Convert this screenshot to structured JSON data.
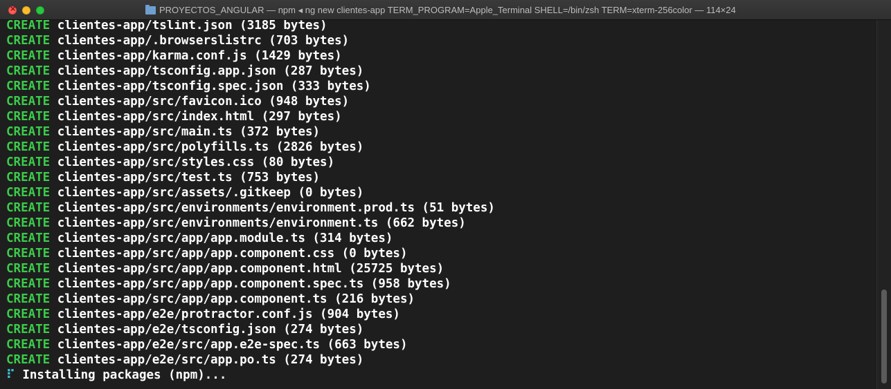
{
  "window": {
    "title": "PROYECTOS_ANGULAR — npm ◂ ng new clientes-app TERM_PROGRAM=Apple_Terminal SHELL=/bin/zsh TERM=xterm-256color — 114×24"
  },
  "colors": {
    "background": "#1e1e1e",
    "keyword_green": "#3bcc4a",
    "text": "#ffffff",
    "spinner_cyan": "#3cc4d8"
  },
  "terminal": {
    "lines": [
      {
        "kw": "CREATE",
        "text": " clientes-app/tslint.json (3185 bytes)"
      },
      {
        "kw": "CREATE",
        "text": " clientes-app/.browserslistrc (703 bytes)"
      },
      {
        "kw": "CREATE",
        "text": " clientes-app/karma.conf.js (1429 bytes)"
      },
      {
        "kw": "CREATE",
        "text": " clientes-app/tsconfig.app.json (287 bytes)"
      },
      {
        "kw": "CREATE",
        "text": " clientes-app/tsconfig.spec.json (333 bytes)"
      },
      {
        "kw": "CREATE",
        "text": " clientes-app/src/favicon.ico (948 bytes)"
      },
      {
        "kw": "CREATE",
        "text": " clientes-app/src/index.html (297 bytes)"
      },
      {
        "kw": "CREATE",
        "text": " clientes-app/src/main.ts (372 bytes)"
      },
      {
        "kw": "CREATE",
        "text": " clientes-app/src/polyfills.ts (2826 bytes)"
      },
      {
        "kw": "CREATE",
        "text": " clientes-app/src/styles.css (80 bytes)"
      },
      {
        "kw": "CREATE",
        "text": " clientes-app/src/test.ts (753 bytes)"
      },
      {
        "kw": "CREATE",
        "text": " clientes-app/src/assets/.gitkeep (0 bytes)"
      },
      {
        "kw": "CREATE",
        "text": " clientes-app/src/environments/environment.prod.ts (51 bytes)"
      },
      {
        "kw": "CREATE",
        "text": " clientes-app/src/environments/environment.ts (662 bytes)"
      },
      {
        "kw": "CREATE",
        "text": " clientes-app/src/app/app.module.ts (314 bytes)"
      },
      {
        "kw": "CREATE",
        "text": " clientes-app/src/app/app.component.css (0 bytes)"
      },
      {
        "kw": "CREATE",
        "text": " clientes-app/src/app/app.component.html (25725 bytes)"
      },
      {
        "kw": "CREATE",
        "text": " clientes-app/src/app/app.component.spec.ts (958 bytes)"
      },
      {
        "kw": "CREATE",
        "text": " clientes-app/src/app/app.component.ts (216 bytes)"
      },
      {
        "kw": "CREATE",
        "text": " clientes-app/e2e/protractor.conf.js (904 bytes)"
      },
      {
        "kw": "CREATE",
        "text": " clientes-app/e2e/tsconfig.json (274 bytes)"
      },
      {
        "kw": "CREATE",
        "text": " clientes-app/e2e/src/app.e2e-spec.ts (663 bytes)"
      },
      {
        "kw": "CREATE",
        "text": " clientes-app/e2e/src/app.po.ts (274 bytes)"
      }
    ],
    "status": {
      "spinner": "⠏",
      "text": " Installing packages (npm)..."
    }
  }
}
